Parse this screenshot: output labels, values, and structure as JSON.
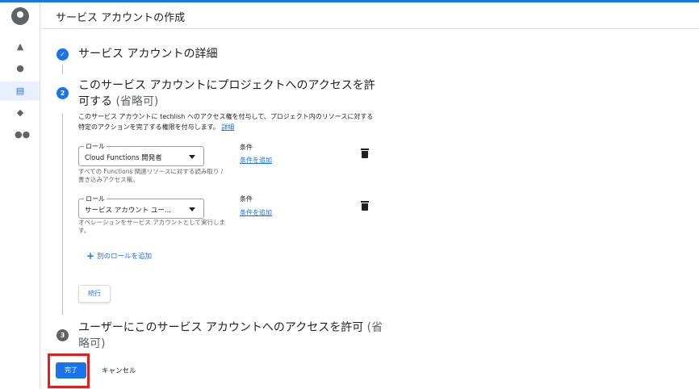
{
  "header": {
    "title": "サービス アカウントの作成"
  },
  "rail": {
    "icons": [
      "cloud-logo-icon",
      "shapes-icon",
      "person-icon",
      "service-account-icon",
      "tag-icon",
      "group-icon"
    ]
  },
  "steps": [
    {
      "number": "✓",
      "title": "サービス アカウントの詳細",
      "optional": ""
    },
    {
      "number": "2",
      "title": "このサービス アカウントにプロジェクトへのアクセスを許可する",
      "optional": "(省略可)"
    },
    {
      "number": "3",
      "title": "ユーザーにこのサービス アカウントへのアクセスを許可",
      "optional": "(省略可)"
    }
  ],
  "step2": {
    "description": "このサービス アカウントに techlish へのアクセス権を付与して、プロジェクト内のリソースに対する特定のアクションを完了する権限を付与します。",
    "details_link": "詳細",
    "roles": [
      {
        "legend": "ロール",
        "value": "Cloud Functions 開発者",
        "hint": "すべての Functions 関連リソースに対する読み取り / 書き込みアクセス権。",
        "condition_label": "条件",
        "condition_link": "条件を追加"
      },
      {
        "legend": "ロール",
        "value": "サービス アカウント ユー...",
        "hint": "オペレーションをサービス アカウントとして実行します。",
        "condition_label": "条件",
        "condition_link": "条件を追加"
      }
    ],
    "add_role": "別のロールを追加",
    "continue": "続行"
  },
  "footer": {
    "done": "完了",
    "cancel": "キャンセル"
  },
  "colors": {
    "accent": "#1a73e8",
    "highlight": "#e0201b"
  }
}
